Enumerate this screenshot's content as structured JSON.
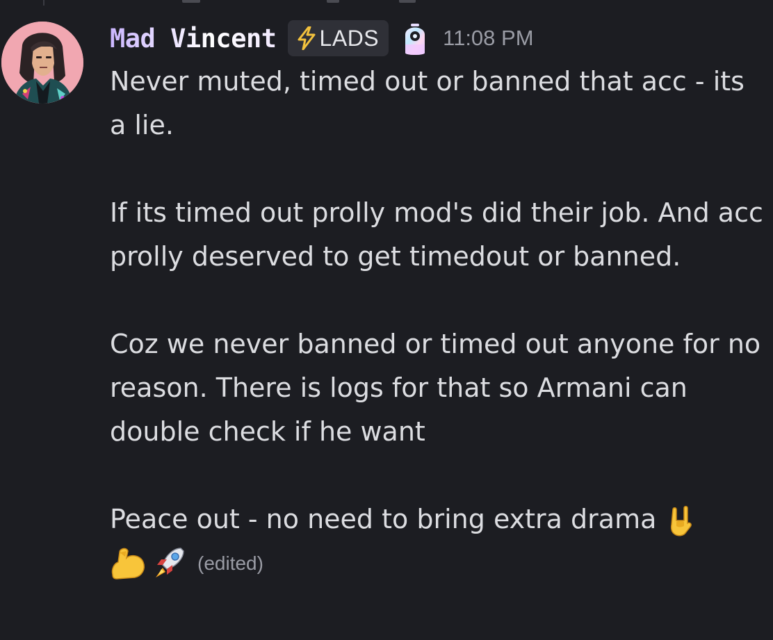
{
  "message": {
    "author": {
      "display_name": "Mad Vincent",
      "name_colors": [
        "#cbb6ff",
        "#ffffff",
        "#f2eaff"
      ],
      "avatar_icon": "avatar-portrait"
    },
    "tag": {
      "icon": "lightning-bolt-icon",
      "label": "LADS"
    },
    "role_icon": "holographic-capsule-icon",
    "timestamp": "11:08 PM",
    "paragraphs": [
      "Never muted, timed out or banned that acc - its a lie.",
      "If its timed out prolly mod's did their job. And acc prolly deserved to get timedout or banned.",
      "Coz we never banned or timed out anyone for no reason. There is logs for that so Armani can double check if he want",
      "Peace out - no need to bring extra drama"
    ],
    "trailing_emojis": [
      "sign-of-the-horns-emoji",
      "flexed-biceps-emoji",
      "rocket-emoji"
    ],
    "edited_label": "(edited)"
  },
  "theme": {
    "background": "#1c1d22",
    "text": "#dcdde1",
    "muted": "#9a9ca5",
    "tag_background": "#2f3037"
  }
}
